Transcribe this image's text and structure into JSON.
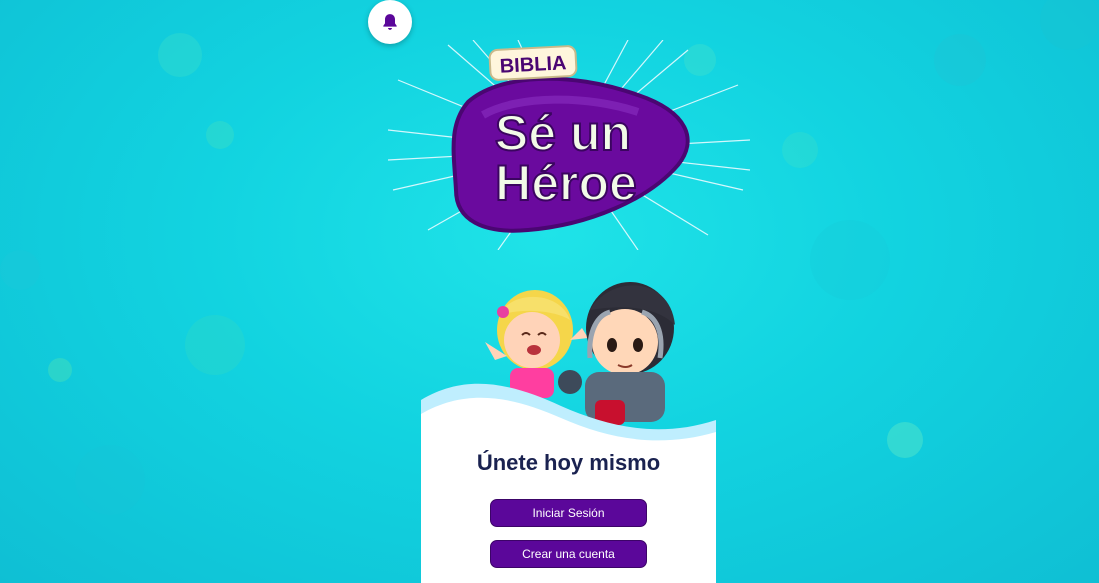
{
  "header": {
    "notification_icon": "bell-icon"
  },
  "logo": {
    "top_word": "BIBLIA",
    "line1": "Sé un",
    "line2": "Héroe"
  },
  "card": {
    "title": "Únete hoy mismo",
    "login_label": "Iniciar Sesión",
    "create_label": "Crear una cuenta"
  },
  "colors": {
    "background": "#12d3e0",
    "brand_purple": "#5b079a",
    "title_navy": "#1a2250",
    "card_white": "#ffffff"
  }
}
